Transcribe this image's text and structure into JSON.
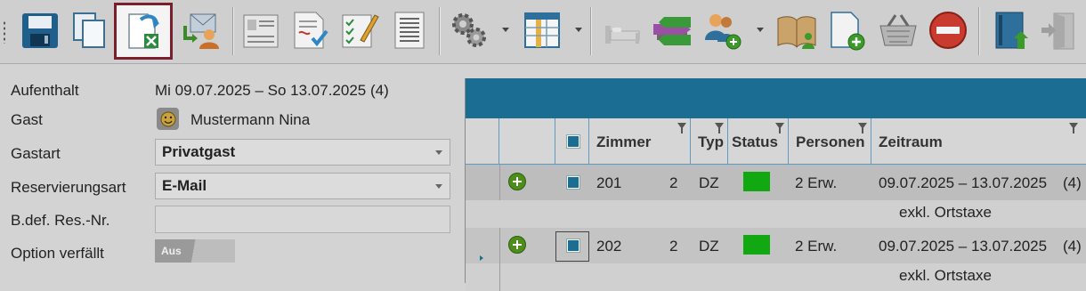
{
  "toolbar": {
    "items": [
      {
        "name": "save-icon",
        "selected": false
      },
      {
        "name": "copy-icon",
        "selected": false
      },
      {
        "name": "export-excel-icon",
        "selected": true
      },
      {
        "name": "send-mail-guest-icon",
        "selected": false
      },
      {
        "name": "registration-card-icon",
        "selected": false
      },
      {
        "name": "invoice-check-icon",
        "selected": false
      },
      {
        "name": "checklist-edit-icon",
        "selected": false
      },
      {
        "name": "document-list-icon",
        "selected": false
      },
      {
        "name": "settings-gears-icon",
        "selected": false
      },
      {
        "name": "table-layout-icon",
        "selected": false
      },
      {
        "name": "bed-icon",
        "selected": false
      },
      {
        "name": "room-move-icon",
        "selected": false
      },
      {
        "name": "add-guests-icon",
        "selected": false
      },
      {
        "name": "open-book-person-icon",
        "selected": false
      },
      {
        "name": "new-document-add-icon",
        "selected": false
      },
      {
        "name": "basket-icon",
        "selected": false
      },
      {
        "name": "cancel-stop-icon",
        "selected": false
      },
      {
        "name": "book-upload-icon",
        "selected": false
      },
      {
        "name": "exit-door-icon",
        "selected": false
      }
    ]
  },
  "form": {
    "stay_label": "Aufenthalt",
    "stay_value": "Mi 09.07.2025 – So 13.07.2025 (4)",
    "guest_label": "Gast",
    "guest_value": "Mustermann Nina",
    "guest_type_label": "Gastart",
    "guest_type_value": "Privatgast",
    "reservation_type_label": "Reservierungsart",
    "reservation_type_value": "E-Mail",
    "booking_ref_label": "B.def. Res.-Nr.",
    "booking_ref_value": "",
    "option_label": "Option verfällt",
    "option_toggle": "Aus"
  },
  "grid": {
    "columns": [
      "Zimmer",
      "Typ",
      "Status",
      "Personen",
      "Zeitraum"
    ],
    "rows": [
      {
        "room": "201",
        "count": "2",
        "type": "DZ",
        "status_color": "#11a811",
        "persons": "2 Erw.",
        "period": "09.07.2025 – 13.07.2025",
        "nights": "(4)",
        "note": "exkl. Ortstaxe"
      },
      {
        "room": "202",
        "count": "2",
        "type": "DZ",
        "status_color": "#11a811",
        "persons": "2 Erw.",
        "period": "09.07.2025 – 13.07.2025",
        "nights": "(4)",
        "note": "exkl. Ortstaxe"
      }
    ]
  }
}
